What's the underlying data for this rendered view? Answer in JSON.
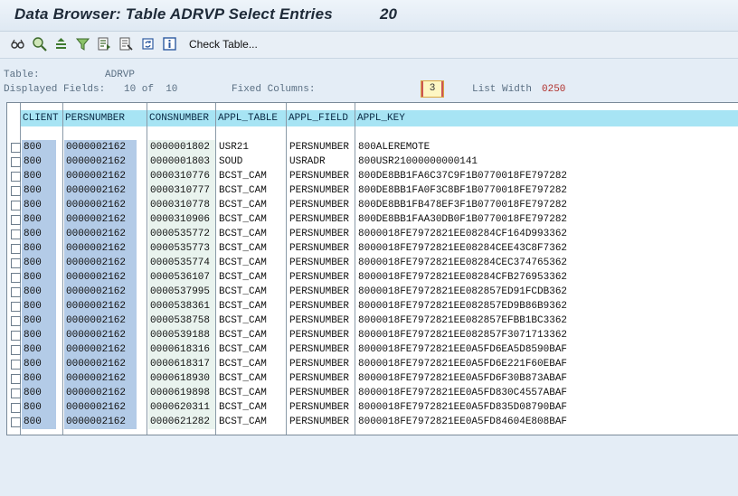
{
  "window": {
    "title": "Data Browser: Table ADRVP Select Entries",
    "hit_count": "20"
  },
  "toolbar": {
    "icons": [
      "glasses-icon",
      "find-icon",
      "sort-ascending-icon",
      "filter-icon",
      "detail-view-icon",
      "change-layout-icon",
      "refresh-icon",
      "info-icon"
    ],
    "check_table_label": "Check Table..."
  },
  "info": {
    "table_label": "Table:",
    "table_value": "ADRVP",
    "displayed_label": "Displayed Fields:",
    "displayed_value": "10 of  10",
    "fixed_columns_label": "Fixed Columns:",
    "fixed_columns_value": "3",
    "list_width_label": "List Width",
    "list_width_value": "0250"
  },
  "columns": [
    "CLIENT",
    "PERSNUMBER",
    "CONSNUMBER",
    "APPL_TABLE",
    "APPL_FIELD",
    "APPL_KEY"
  ],
  "rows": [
    [
      "800",
      "0000002162",
      "0000001802",
      "USR21",
      "PERSNUMBER",
      "800ALEREMOTE"
    ],
    [
      "800",
      "0000002162",
      "0000001803",
      "SOUD",
      "USRADR",
      "800USR21000000000141"
    ],
    [
      "800",
      "0000002162",
      "0000310776",
      "BCST_CAM",
      "PERSNUMBER",
      "800DE8BB1FA6C37C9F1B0770018FE797282"
    ],
    [
      "800",
      "0000002162",
      "0000310777",
      "BCST_CAM",
      "PERSNUMBER",
      "800DE8BB1FA0F3C8BF1B0770018FE797282"
    ],
    [
      "800",
      "0000002162",
      "0000310778",
      "BCST_CAM",
      "PERSNUMBER",
      "800DE8BB1FB478EF3F1B0770018FE797282"
    ],
    [
      "800",
      "0000002162",
      "0000310906",
      "BCST_CAM",
      "PERSNUMBER",
      "800DE8BB1FAA30DB0F1B0770018FE797282"
    ],
    [
      "800",
      "0000002162",
      "0000535772",
      "BCST_CAM",
      "PERSNUMBER",
      "8000018FE7972821EE08284CF164D993362"
    ],
    [
      "800",
      "0000002162",
      "0000535773",
      "BCST_CAM",
      "PERSNUMBER",
      "8000018FE7972821EE08284CEE43C8F7362"
    ],
    [
      "800",
      "0000002162",
      "0000535774",
      "BCST_CAM",
      "PERSNUMBER",
      "8000018FE7972821EE08284CEC374765362"
    ],
    [
      "800",
      "0000002162",
      "0000536107",
      "BCST_CAM",
      "PERSNUMBER",
      "8000018FE7972821EE08284CFB276953362"
    ],
    [
      "800",
      "0000002162",
      "0000537995",
      "BCST_CAM",
      "PERSNUMBER",
      "8000018FE7972821EE082857ED91FCDB362"
    ],
    [
      "800",
      "0000002162",
      "0000538361",
      "BCST_CAM",
      "PERSNUMBER",
      "8000018FE7972821EE082857ED9B86B9362"
    ],
    [
      "800",
      "0000002162",
      "0000538758",
      "BCST_CAM",
      "PERSNUMBER",
      "8000018FE7972821EE082857EFBB1BC3362"
    ],
    [
      "800",
      "0000002162",
      "0000539188",
      "BCST_CAM",
      "PERSNUMBER",
      "8000018FE7972821EE082857F3071713362"
    ],
    [
      "800",
      "0000002162",
      "0000618316",
      "BCST_CAM",
      "PERSNUMBER",
      "8000018FE7972821EE0A5FD6EA5D8590BAF"
    ],
    [
      "800",
      "0000002162",
      "0000618317",
      "BCST_CAM",
      "PERSNUMBER",
      "8000018FE7972821EE0A5FD6E221F60EBAF"
    ],
    [
      "800",
      "0000002162",
      "0000618930",
      "BCST_CAM",
      "PERSNUMBER",
      "8000018FE7972821EE0A5FD6F30B873ABAF"
    ],
    [
      "800",
      "0000002162",
      "0000619898",
      "BCST_CAM",
      "PERSNUMBER",
      "8000018FE7972821EE0A5FD830C4557ABAF"
    ],
    [
      "800",
      "0000002162",
      "0000620311",
      "BCST_CAM",
      "PERSNUMBER",
      "8000018FE7972821EE0A5FD835D08790BAF"
    ],
    [
      "800",
      "0000002162",
      "0000621282",
      "BCST_CAM",
      "PERSNUMBER",
      "8000018FE7972821EE0A5FD84604E808BAF"
    ]
  ],
  "colors": {
    "header_bg": "#a7e4f4",
    "key_col_bg": "#b3cbe7",
    "fixed_col_bg": "#e9f3ee",
    "list_width_value": "#b0302c"
  }
}
